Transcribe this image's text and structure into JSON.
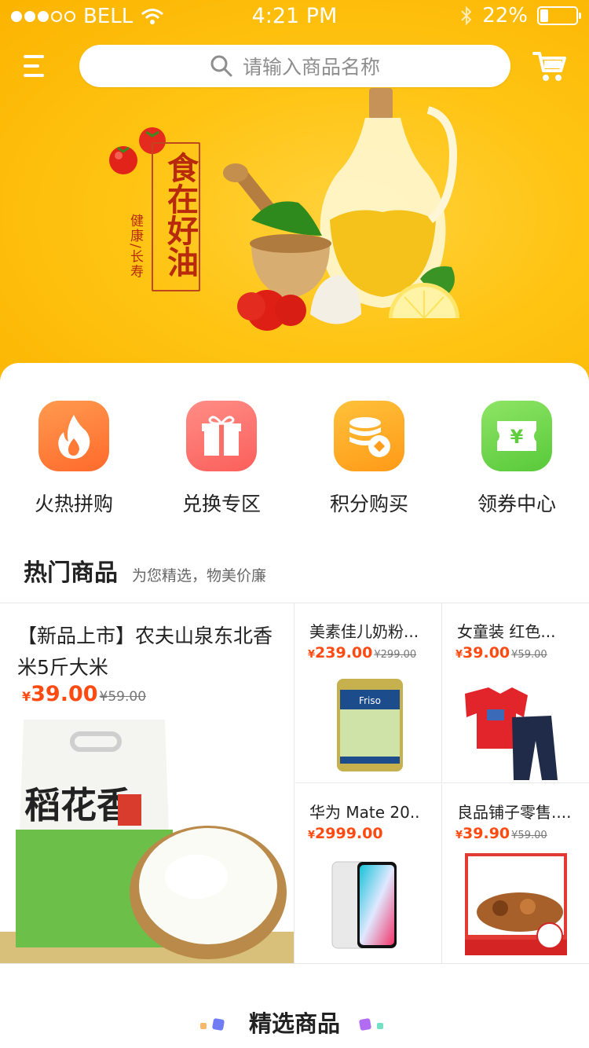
{
  "status_bar": {
    "carrier": "BELL",
    "time": "4:21 PM",
    "battery": "22%"
  },
  "search": {
    "placeholder": "请输入商品名称"
  },
  "banner": {
    "slogan": "食在好油",
    "sub": "健康/长寿"
  },
  "quick_menu": [
    {
      "label": "火热拼购",
      "icon": "fire-icon"
    },
    {
      "label": "兑换专区",
      "icon": "gift-icon"
    },
    {
      "label": "积分购买",
      "icon": "coin-stack-icon"
    },
    {
      "label": "领券中心",
      "icon": "yen-ticket-icon"
    }
  ],
  "hot_section": {
    "title": "热门商品",
    "subtitle": "为您精选，物美价廉"
  },
  "products": [
    {
      "name": "【新品上市】农夫山泉东北香米5斤大米",
      "currency": "¥",
      "price": "39.00",
      "old_price": "¥59.00"
    },
    {
      "name": "美素佳儿奶粉...",
      "currency": "¥",
      "price": "239.00",
      "old_price": "¥299.00"
    },
    {
      "name": "女童装 红色...",
      "currency": "¥",
      "price": "39.00",
      "old_price": "¥59.00"
    },
    {
      "name": "华为 Mate 20..",
      "currency": "¥",
      "price": "2999.00",
      "old_price": ""
    },
    {
      "name": "良品铺子零售....",
      "currency": "¥",
      "price": "39.90",
      "old_price": "¥59.00"
    }
  ],
  "featured_section": {
    "title": "精选商品"
  },
  "colors": {
    "brand_yellow": "#ffc413",
    "price_red": "#ff4a12"
  }
}
